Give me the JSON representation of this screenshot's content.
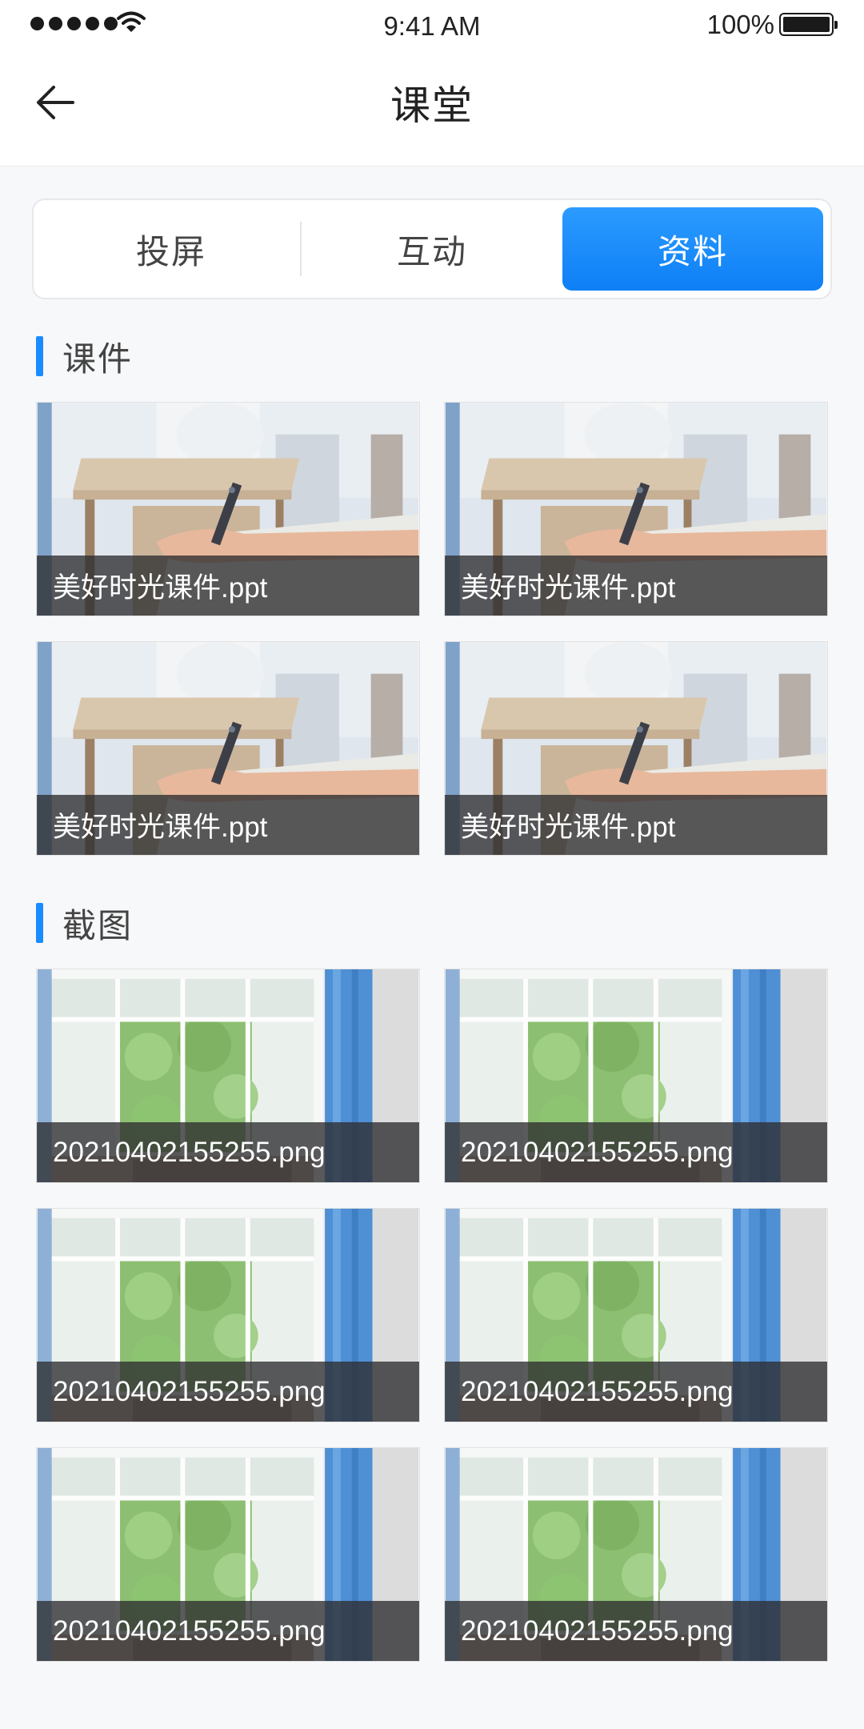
{
  "status_bar": {
    "time": "9:41 AM",
    "battery": "100%",
    "icons": [
      "signal-dots-icon",
      "wifi-icon",
      "battery-icon"
    ]
  },
  "nav": {
    "title": "课堂",
    "back_icon": "arrow-left-icon"
  },
  "tabs": [
    {
      "label": "投屏",
      "active": false
    },
    {
      "label": "互动",
      "active": false
    },
    {
      "label": "资料",
      "active": true
    }
  ],
  "colors": {
    "accent": "#1a8cff",
    "active_tab_top": "#2b9bff",
    "active_tab_bottom": "#0e7ff5",
    "page_bg": "#f7f8fa"
  },
  "sections": {
    "courseware": {
      "title": "课件",
      "items": [
        {
          "name": "美好时光课件.ppt"
        },
        {
          "name": "美好时光课件.ppt"
        },
        {
          "name": "美好时光课件.ppt"
        },
        {
          "name": "美好时光课件.ppt"
        }
      ]
    },
    "screenshots": {
      "title": "截图",
      "items": [
        {
          "name": "20210402155255.png"
        },
        {
          "name": "20210402155255.png"
        },
        {
          "name": "20210402155255.png"
        },
        {
          "name": "20210402155255.png"
        },
        {
          "name": "20210402155255.png"
        },
        {
          "name": "20210402155255.png"
        }
      ]
    }
  }
}
